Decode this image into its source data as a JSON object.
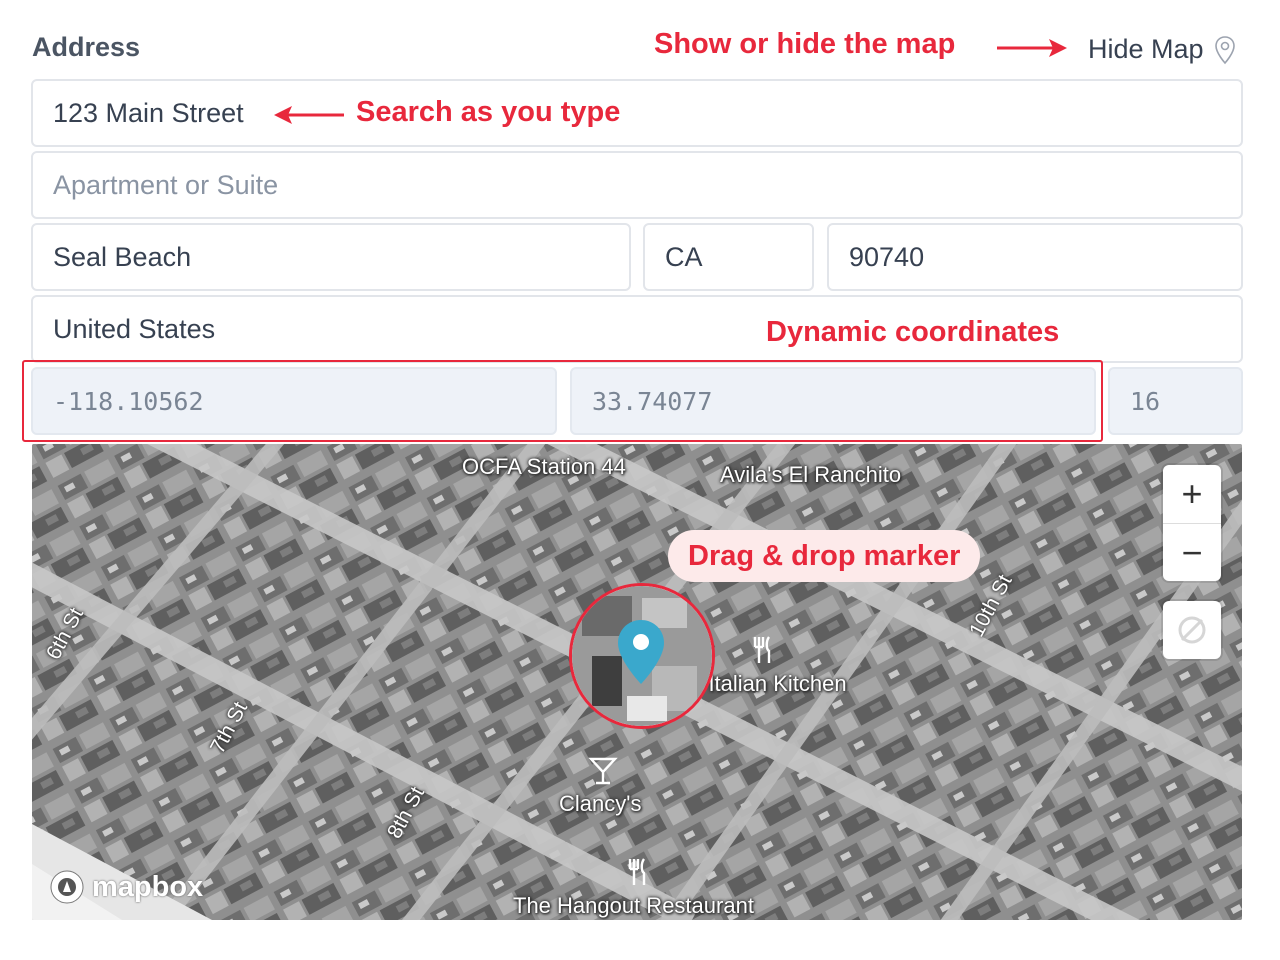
{
  "header": {
    "label": "Address",
    "hide_map": "Hide Map"
  },
  "form": {
    "street": "123 Main Street",
    "apartment_placeholder": "Apartment or Suite",
    "city": "Seal Beach",
    "state": "CA",
    "zip": "90740",
    "country": "United States",
    "longitude": "-118.10562",
    "latitude": "33.74077",
    "zoom": "16"
  },
  "annotations": {
    "show_hide": "Show or hide the map",
    "search": "Search as you type",
    "coordinates": "Dynamic coordinates",
    "drag": "Drag & drop marker"
  },
  "map": {
    "pois": {
      "ocfa": "OCFA Station 44",
      "avilas": "Avila's El Ranchito",
      "italian": "My Italian Kitchen",
      "clancys": "Clancy's",
      "hangout": "The Hangout Restaurant"
    },
    "streets": {
      "s6": "6th St",
      "s7": "7th St",
      "s8": "8th St",
      "s10": "10th St"
    },
    "controls": {
      "zoom_in": "+",
      "zoom_out": "−"
    },
    "attribution": "mapbox"
  },
  "colors": {
    "annotation": "#e8283c",
    "marker": "#3aa8cc",
    "coord_bg": "#eef2f8"
  }
}
